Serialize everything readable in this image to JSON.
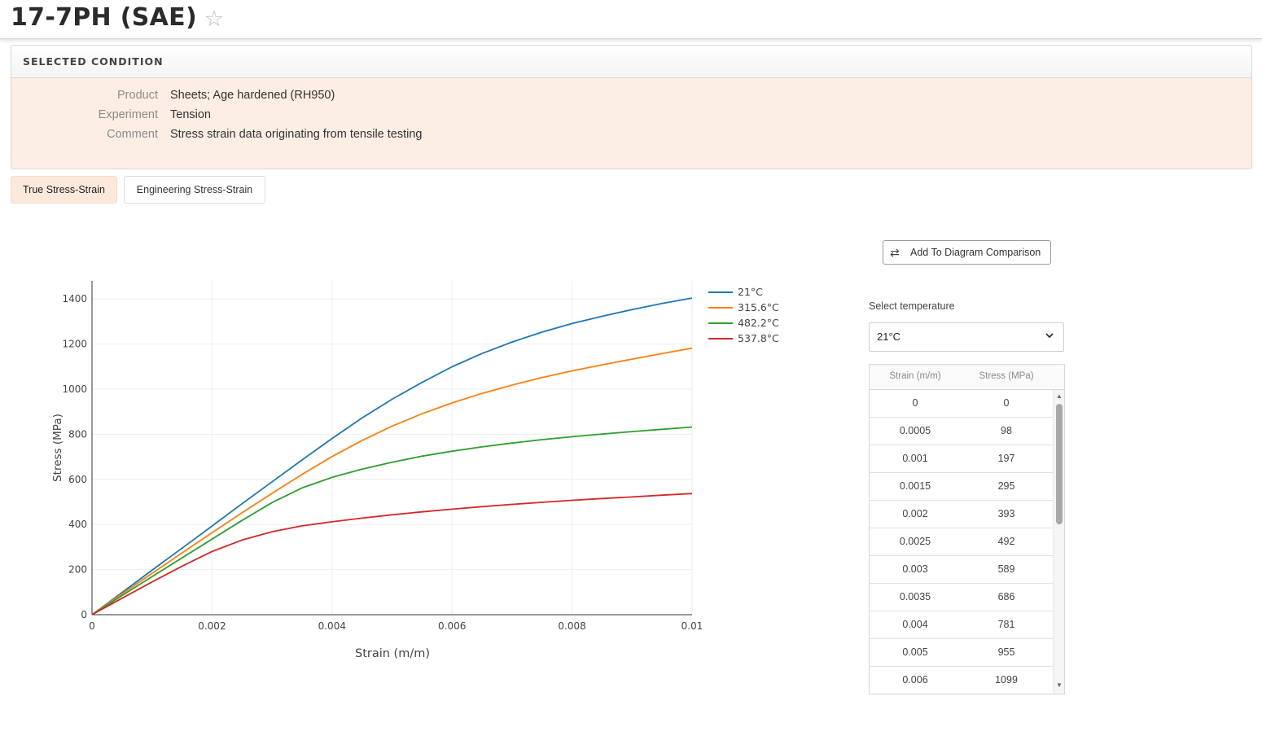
{
  "header": {
    "title": "17-7PH (SAE)"
  },
  "condition": {
    "heading": "SELECTED CONDITION",
    "rows": [
      {
        "key": "Product",
        "value": "Sheets; Age hardened (RH950)"
      },
      {
        "key": "Experiment",
        "value": "Tension"
      },
      {
        "key": "Comment",
        "value": "Stress strain data originating from tensile testing"
      }
    ]
  },
  "tabs": [
    {
      "label": "True Stress-Strain",
      "active": true
    },
    {
      "label": "Engineering Stress-Strain",
      "active": false
    }
  ],
  "compare_button": {
    "label": "Add To Diagram Comparison",
    "icon": "compare-arrows-icon"
  },
  "temperature_select": {
    "label": "Select temperature",
    "value": "21°C"
  },
  "table": {
    "headers": [
      "Strain (m/m)",
      "Stress (MPa)"
    ],
    "rows": [
      [
        "0",
        "0"
      ],
      [
        "0.0005",
        "98"
      ],
      [
        "0.001",
        "197"
      ],
      [
        "0.0015",
        "295"
      ],
      [
        "0.002",
        "393"
      ],
      [
        "0.0025",
        "492"
      ],
      [
        "0.003",
        "589"
      ],
      [
        "0.0035",
        "686"
      ],
      [
        "0.004",
        "781"
      ],
      [
        "0.005",
        "955"
      ],
      [
        "0.006",
        "1099"
      ]
    ]
  },
  "colors": {
    "accent_bg": "#fdeee3",
    "active_tab_bg": "#fde9dc"
  },
  "chart_data": {
    "type": "line",
    "xlabel": "Strain (m/m)",
    "ylabel": "Stress (MPa)",
    "xlim": [
      0,
      0.01
    ],
    "ylim": [
      0,
      1480
    ],
    "x_ticks": [
      0,
      0.002,
      0.004,
      0.006,
      0.008,
      0.01
    ],
    "x_tick_labels": [
      "0",
      "0.002",
      "0.004",
      "0.006",
      "0.008",
      "0.01"
    ],
    "y_ticks": [
      0,
      200,
      400,
      600,
      800,
      1000,
      1200,
      1400
    ],
    "y_tick_labels": [
      "0",
      "200",
      "400",
      "600",
      "800",
      "1000",
      "1200",
      "1400"
    ],
    "grid": true,
    "legend_position": "top-right",
    "series": [
      {
        "name": "21°C",
        "color": "#1f77b4",
        "x": [
          0,
          0.0005,
          0.001,
          0.0015,
          0.002,
          0.0025,
          0.003,
          0.0035,
          0.004,
          0.0045,
          0.005,
          0.0055,
          0.006,
          0.0065,
          0.007,
          0.0075,
          0.008,
          0.0085,
          0.009,
          0.0095,
          0.01
        ],
        "y": [
          0,
          98,
          197,
          295,
          393,
          492,
          589,
          686,
          781,
          872,
          955,
          1030,
          1099,
          1158,
          1209,
          1253,
          1291,
          1323,
          1353,
          1380,
          1404
        ]
      },
      {
        "name": "315.6°C",
        "color": "#ff7f0e",
        "x": [
          0,
          0.0005,
          0.001,
          0.0015,
          0.002,
          0.0025,
          0.003,
          0.0035,
          0.004,
          0.0045,
          0.005,
          0.0055,
          0.006,
          0.0065,
          0.007,
          0.0075,
          0.008,
          0.0085,
          0.009,
          0.0095,
          0.01
        ],
        "y": [
          0,
          92,
          183,
          274,
          364,
          452,
          538,
          622,
          701,
          772,
          836,
          891,
          939,
          981,
          1018,
          1051,
          1081,
          1108,
          1133,
          1158,
          1182
        ]
      },
      {
        "name": "482.2°C",
        "color": "#2ca02c",
        "x": [
          0,
          0.0005,
          0.001,
          0.0015,
          0.002,
          0.0025,
          0.003,
          0.0035,
          0.004,
          0.0045,
          0.005,
          0.0055,
          0.006,
          0.0065,
          0.007,
          0.0075,
          0.008,
          0.0085,
          0.009,
          0.0095,
          0.01
        ],
        "y": [
          0,
          85,
          169,
          252,
          335,
          418,
          497,
          562,
          609,
          645,
          676,
          703,
          725,
          744,
          761,
          776,
          789,
          801,
          812,
          822,
          832
        ]
      },
      {
        "name": "537.8°C",
        "color": "#d62728",
        "x": [
          0,
          0.0005,
          0.001,
          0.0015,
          0.002,
          0.0025,
          0.003,
          0.0035,
          0.004,
          0.0045,
          0.005,
          0.0055,
          0.006,
          0.0065,
          0.007,
          0.0075,
          0.008,
          0.0085,
          0.009,
          0.0095,
          0.01
        ],
        "y": [
          0,
          73,
          145,
          215,
          280,
          331,
          368,
          394,
          412,
          428,
          443,
          456,
          468,
          479,
          489,
          498,
          507,
          515,
          522,
          530,
          537
        ]
      }
    ]
  }
}
